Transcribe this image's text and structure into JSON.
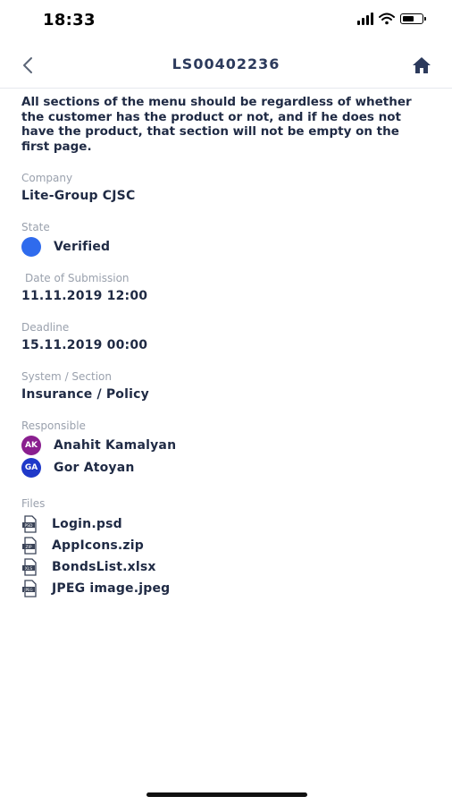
{
  "status_bar": {
    "time": "18:33",
    "signal_bars": 4,
    "battery_level": 0.6
  },
  "header": {
    "title": "LS00402236",
    "back_icon": "chevron-left-icon",
    "home_icon": "home-icon"
  },
  "description": "All sections of the menu should be regardless of whether the customer has the product or not, and if he does not have the product, that section will not be empty on the first page.",
  "company": {
    "label": "Company",
    "value": "Lite-Group CJSC"
  },
  "state": {
    "label": "State",
    "value": "Verified",
    "color": "#2f6bed"
  },
  "submission": {
    "label": "Date of Submission",
    "value": "11.11.2019 12:00"
  },
  "deadline": {
    "label": "Deadline",
    "value": "15.11.2019 00:00"
  },
  "system_section": {
    "label": "System / Section",
    "value": "Insurance / Policy"
  },
  "responsible": {
    "label": "Responsible",
    "people": [
      {
        "initials": "AK",
        "name": "Anahit Kamalyan",
        "color": "#8a1f8f"
      },
      {
        "initials": "GA",
        "name": "Gor Atoyan",
        "color": "#1f39c9"
      }
    ]
  },
  "files": {
    "label": "Files",
    "items": [
      {
        "name": "Login.psd",
        "ext": "PSD",
        "icon": "psd-file-icon"
      },
      {
        "name": "AppIcons.zip",
        "ext": "ZIP",
        "icon": "zip-file-icon"
      },
      {
        "name": "BondsList.xlsx",
        "ext": "XLS",
        "icon": "xlsx-file-icon"
      },
      {
        "name": "JPEG image.jpeg",
        "ext": "JPEG",
        "icon": "jpeg-file-icon"
      }
    ]
  }
}
